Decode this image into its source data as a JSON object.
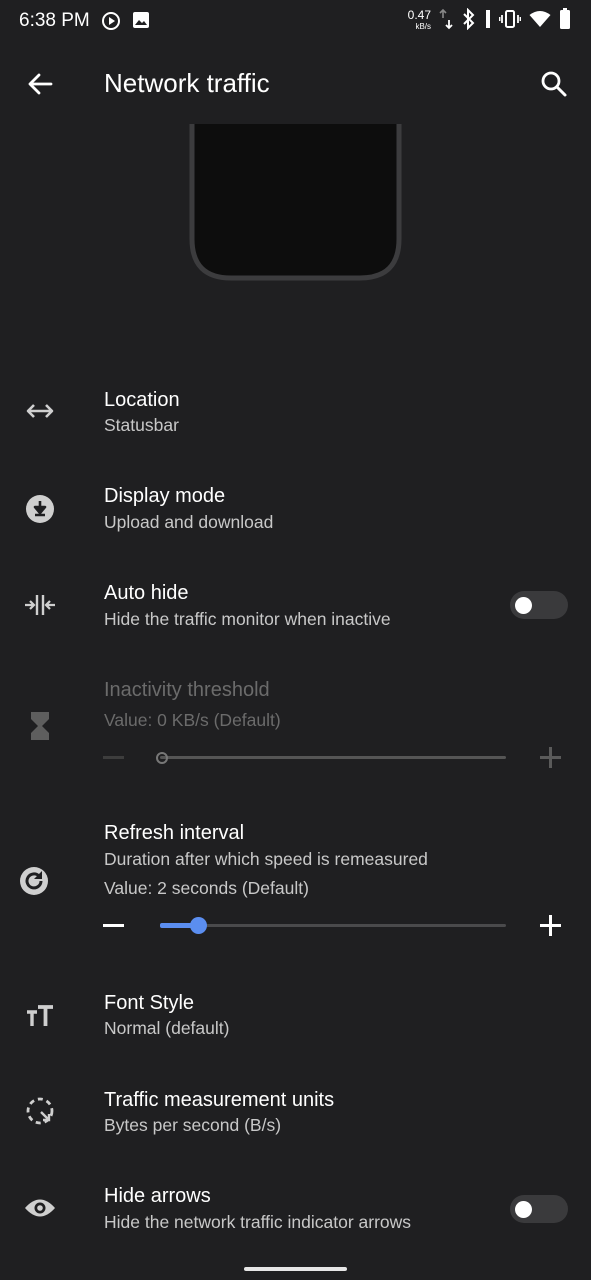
{
  "status_bar": {
    "time": "6:38 PM",
    "net_speed_value": "0.47",
    "net_speed_unit": "kB/s",
    "icons": [
      "media-play-icon",
      "image-icon",
      "upload-download-icon",
      "bluetooth-icon",
      "vibrate-icon",
      "wifi-icon",
      "battery-icon"
    ]
  },
  "toolbar": {
    "title": "Network traffic",
    "back_icon": "arrow-back-icon",
    "search_icon": "search-icon"
  },
  "settings": {
    "location": {
      "title": "Location",
      "summary": "Statusbar",
      "icon": "horizontal-arrows-icon"
    },
    "display_mode": {
      "title": "Display mode",
      "summary": "Upload and download",
      "icon": "download-circle-icon"
    },
    "auto_hide": {
      "title": "Auto hide",
      "summary": "Hide the traffic monitor when inactive",
      "icon": "compress-icon",
      "enabled": false
    },
    "inactivity_threshold": {
      "title": "Inactivity threshold",
      "summary": "Value: 0 KB/s (Default)",
      "icon": "hourglass-icon",
      "disabled": true,
      "slider_fraction": 0.0
    },
    "refresh_interval": {
      "title": "Refresh interval",
      "summary": "Duration after which speed is remeasured",
      "value_text": "Value: 2 seconds (Default)",
      "icon": "refresh-icon",
      "slider_fraction": 0.11
    },
    "font_style": {
      "title": "Font Style",
      "summary": "Normal (default)",
      "icon": "text-size-icon"
    },
    "measurement_units": {
      "title": "Traffic measurement units",
      "summary": "Bytes per second (B/s)",
      "icon": "dashed-circle-arrow-icon"
    },
    "hide_arrows": {
      "title": "Hide arrows",
      "summary": "Hide the network traffic indicator arrows",
      "icon": "eye-icon",
      "enabled": false
    }
  },
  "colors": {
    "background": "#1f1f21",
    "accent": "#5b8ef0",
    "text_primary": "#ffffff",
    "text_secondary": "#c8c8c8",
    "text_disabled": "#6b6b6b"
  }
}
